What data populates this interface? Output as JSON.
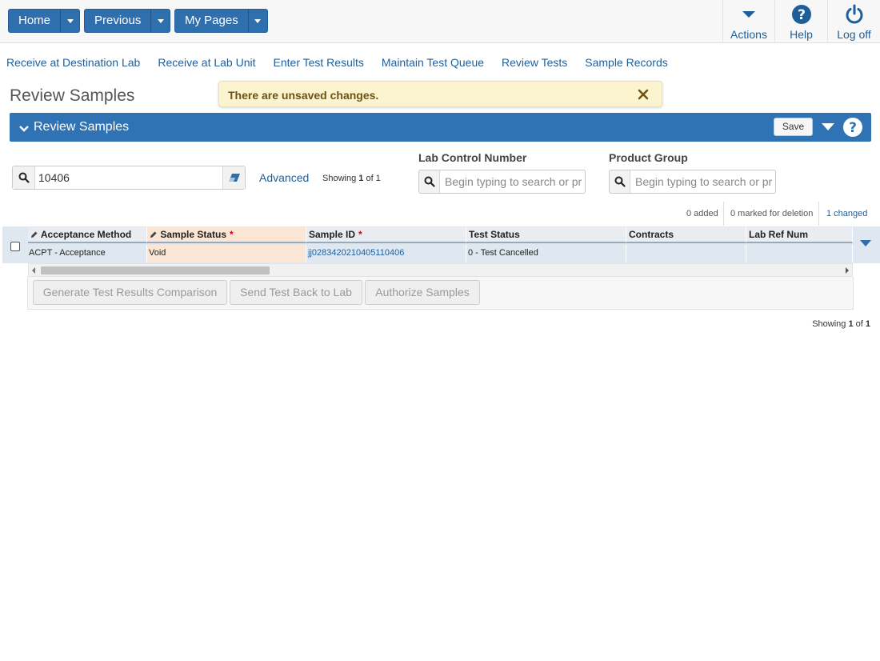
{
  "topnav": {
    "home": "Home",
    "previous": "Previous",
    "my_pages": "My Pages",
    "actions": "Actions",
    "help": "Help",
    "logoff": "Log off"
  },
  "links": [
    "Receive at Destination Lab",
    "Receive at Lab Unit",
    "Enter Test Results",
    "Maintain Test Queue",
    "Review Tests",
    "Sample Records"
  ],
  "page_title": "Review Samples",
  "alert": {
    "message": "There are unsaved changes."
  },
  "panel": {
    "title": "Review Samples",
    "save_label": "Save"
  },
  "search": {
    "value": "10406",
    "advanced": "Advanced",
    "showing_prefix": "Showing ",
    "showing_current": "1",
    "showing_of": " of 1"
  },
  "filters": {
    "lab_control_number": {
      "label": "Lab Control Number",
      "placeholder": "Begin typing to search or pr"
    },
    "product_group": {
      "label": "Product Group",
      "placeholder": "Begin typing to search or pr"
    }
  },
  "counts": {
    "added": "0 added",
    "deleted": "0 marked for deletion",
    "changed": "1 changed"
  },
  "grid": {
    "columns": [
      "Acceptance Method",
      "Sample Status",
      "Sample ID",
      "Test Status",
      "Contracts",
      "Lab Ref Num"
    ],
    "required_marker": "*",
    "row": [
      "ACPT - Acceptance",
      "Void",
      "jj0283420210405110406",
      "0 - Test Cancelled",
      "",
      ""
    ]
  },
  "buttons": {
    "generate": "Generate Test Results Comparison",
    "send_back": "Send Test Back to Lab",
    "authorize": "Authorize Samples"
  },
  "footer": {
    "showing_prefix": "Showing ",
    "current": "1",
    "of": " of ",
    "total": "1"
  },
  "colors": {
    "primary": "#2f73b4",
    "link": "#1e5f9a",
    "alert_bg": "#fcf3cf",
    "edited_cell": "#fbe6d6",
    "required": "#d0021b"
  }
}
